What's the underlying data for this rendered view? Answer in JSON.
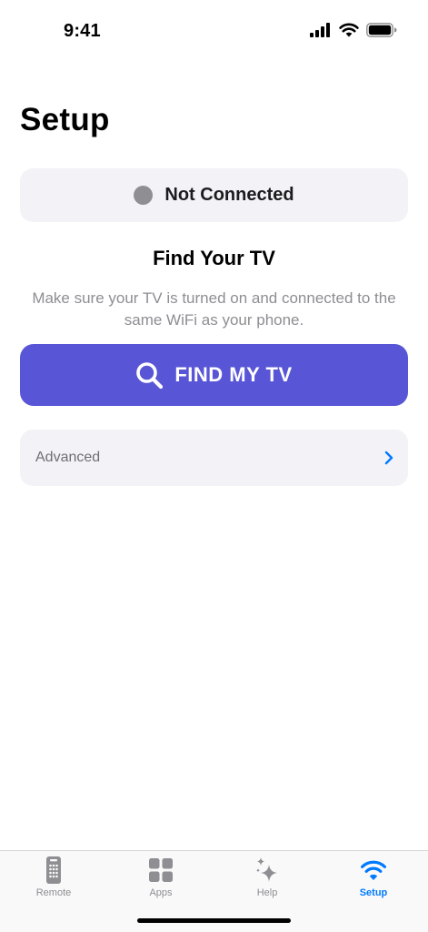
{
  "status_bar": {
    "time": "9:41",
    "icons": [
      "cellular-signal-icon",
      "wifi-icon",
      "battery-icon"
    ]
  },
  "page": {
    "title": "Setup"
  },
  "connection": {
    "status": "Not Connected",
    "dot_color": "#8e8e93"
  },
  "find_section": {
    "heading": "Find Your TV",
    "description": "Make sure your TV is turned on and connected to the same WiFi as your phone.",
    "button_label": "FIND MY TV",
    "button_icon": "search-icon",
    "button_color": "#5856d6"
  },
  "advanced": {
    "label": "Advanced",
    "icon": "chevron-right-icon"
  },
  "tab_bar": {
    "items": [
      {
        "label": "Remote",
        "icon": "remote-icon",
        "active": false
      },
      {
        "label": "Apps",
        "icon": "apps-grid-icon",
        "active": false
      },
      {
        "label": "Help",
        "icon": "sparkles-icon",
        "active": false
      },
      {
        "label": "Setup",
        "icon": "wifi-icon",
        "active": true
      }
    ],
    "active_color": "#007aff",
    "inactive_color": "#8e8e93"
  }
}
